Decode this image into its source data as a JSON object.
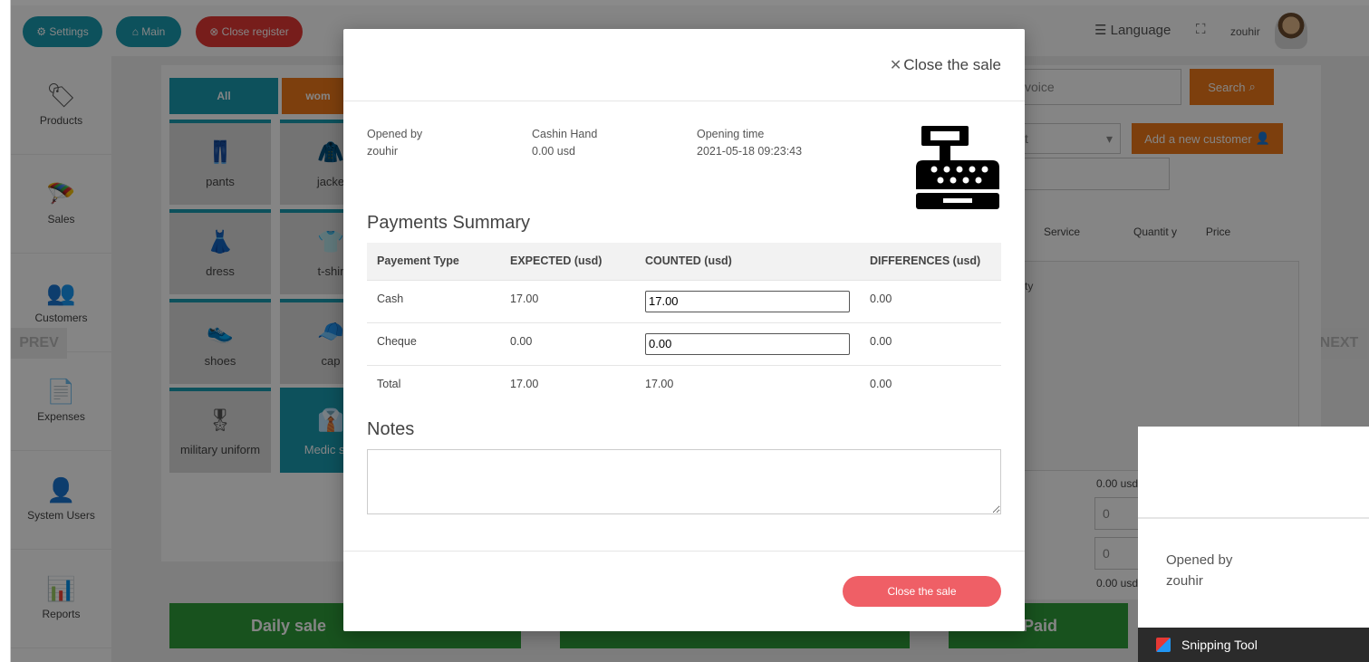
{
  "topbar": {
    "settings": "⚙ Settings",
    "main": "⌂ Main",
    "close_register": "⊗ Close register",
    "language": "☰ Language",
    "user": "zouhir"
  },
  "sidebar": [
    {
      "icon": "🏷",
      "label": "Products",
      "name": "tag-icon"
    },
    {
      "icon": "🪂",
      "label": "Sales",
      "name": "sales-icon"
    },
    {
      "icon": "👥",
      "label": "Customers",
      "name": "customers-icon"
    },
    {
      "icon": "📄",
      "label": "Expenses",
      "name": "document-icon"
    },
    {
      "icon": "👤",
      "label": "System Users",
      "name": "user-icon"
    },
    {
      "icon": "📊",
      "label": "Reports",
      "name": "reports-icon"
    }
  ],
  "categories": {
    "tab_all": "All",
    "tab_women": "wom",
    "items": [
      {
        "label": "pants",
        "icon": "👖"
      },
      {
        "label": "jacke",
        "icon": "🧥"
      },
      {
        "label": "dress",
        "icon": "👗"
      },
      {
        "label": "t-shir",
        "icon": "👕"
      },
      {
        "label": "shoes",
        "icon": "👟"
      },
      {
        "label": "cap",
        "icon": "🧢"
      },
      {
        "label": "military uniform",
        "icon": "🎖"
      },
      {
        "label": "Medic suit",
        "icon": "👔"
      }
    ]
  },
  "nav": {
    "prev": "PREV",
    "next": "NEXT"
  },
  "right": {
    "invoice_placeholder": "voice",
    "search": "Search",
    "customer_select": "t",
    "add_customer": "Add a new customer",
    "col_service": "Service",
    "col_quantity": "Quantit y",
    "col_price": "Price",
    "row_fragment": "ty",
    "total1": "0.00 usd",
    "input1": "0",
    "input2": "0",
    "total2": "0.00 usd",
    "paid": "Paid",
    "daily_sale": "Daily sale"
  },
  "modal": {
    "close_link": "Close the sale",
    "opened_by_label": "Opened by",
    "opened_by_value": "zouhir",
    "cashin_label": "Cashin Hand",
    "cashin_value": "0.00 usd",
    "opening_time_label": "Opening time",
    "opening_time_value": "2021-05-18 09:23:43",
    "summary_title": "Payments Summary",
    "columns": [
      "Payement Type",
      "EXPECTED (usd)",
      "COUNTED (usd)",
      "DIFFERENCES (usd)"
    ],
    "rows": [
      {
        "type": "Cash",
        "expected": "17.00",
        "counted": "17.00",
        "difference": "0.00"
      },
      {
        "type": "Cheque",
        "expected": "0.00",
        "counted": "0.00",
        "difference": "0.00"
      }
    ],
    "total": {
      "type": "Total",
      "expected": "17.00",
      "counted": "17.00",
      "difference": "0.00"
    },
    "notes_title": "Notes",
    "notes_value": "",
    "close_button": "Close the sale"
  },
  "snipping": {
    "opened_by_label": "Opened by",
    "opened_by_value": "zouhir",
    "taskbar_label": "Snipping Tool"
  }
}
